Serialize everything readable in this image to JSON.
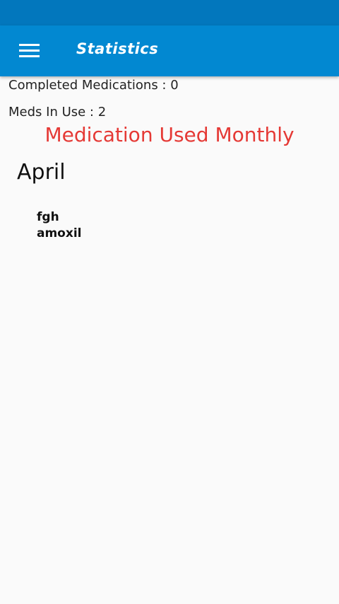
{
  "header": {
    "title": "Statistics",
    "menu_icon": "hamburger-menu-icon"
  },
  "stats": {
    "completed": "Completed Medications : 0",
    "in_use": "Meds In Use : 2"
  },
  "section": {
    "title": "Medication Used Monthly"
  },
  "months": [
    {
      "name": "April",
      "medications": [
        "fgh",
        "amoxil"
      ]
    }
  ],
  "colors": {
    "status_bar": "#0277bd",
    "app_bar": "#0288d1",
    "section_title": "#e53935",
    "background": "#fafafa"
  }
}
